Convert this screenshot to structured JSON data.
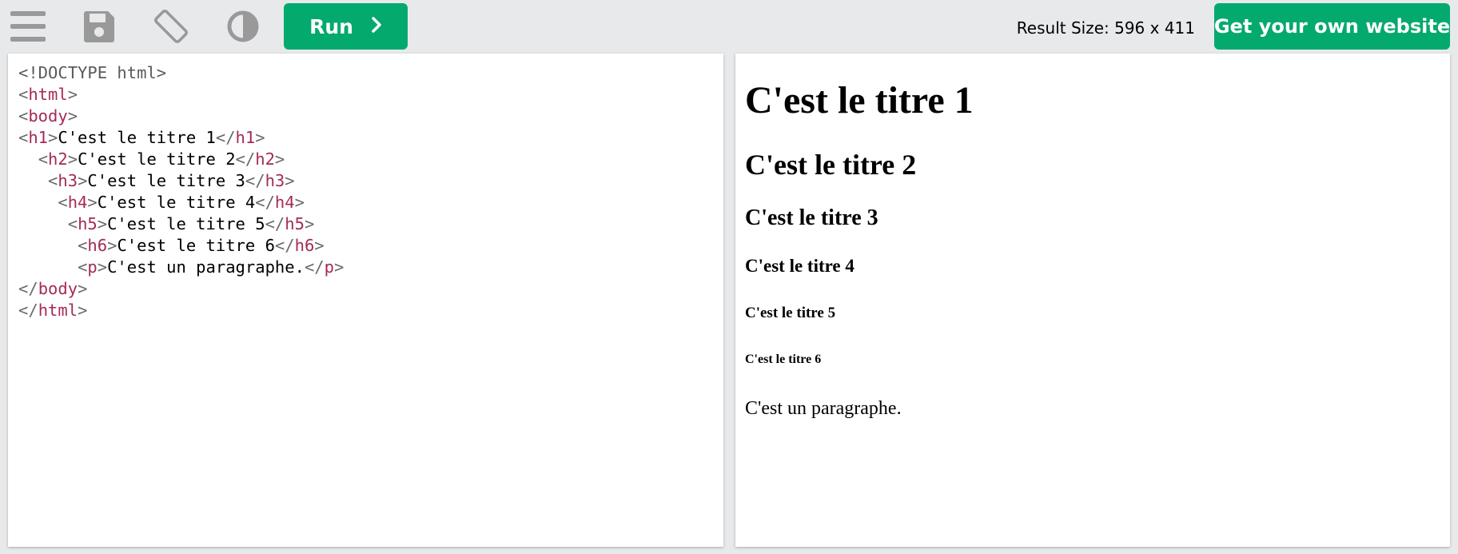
{
  "toolbar": {
    "menu_icon": "hamburger-menu-icon",
    "save_icon": "floppy-disk-icon",
    "rotate_icon": "rotate-screen-icon",
    "contrast_icon": "contrast-half-circle-icon",
    "run_label": "Run",
    "run_icon": "chevron-right-icon",
    "result_size": "Result Size: 596 x 411",
    "get_website_label": "Get your own website"
  },
  "colors": {
    "accent": "#04aa6d",
    "background": "#e7e9eb",
    "tag_color": "#a52a5a",
    "icon_color": "#999999"
  },
  "editor": {
    "lines": [
      {
        "indent": "",
        "text": "<!DOCTYPE html>",
        "kind": "doctype"
      },
      {
        "indent": "",
        "open": "html",
        "kind": "open"
      },
      {
        "indent": "",
        "open": "body",
        "kind": "open"
      },
      {
        "indent": "",
        "tag": "h1",
        "content": "C'est le titre 1",
        "kind": "element"
      },
      {
        "indent": "  ",
        "tag": "h2",
        "content": "C'est le titre 2",
        "kind": "element"
      },
      {
        "indent": "   ",
        "tag": "h3",
        "content": "C'est le titre 3",
        "kind": "element"
      },
      {
        "indent": "    ",
        "tag": "h4",
        "content": "C'est le titre 4",
        "kind": "element"
      },
      {
        "indent": "     ",
        "tag": "h5",
        "content": "C'est le titre 5",
        "kind": "element"
      },
      {
        "indent": "      ",
        "tag": "h6",
        "content": "C'est le titre 6",
        "kind": "element"
      },
      {
        "indent": "      ",
        "tag": "p",
        "content": "C'est un paragraphe.",
        "kind": "element"
      },
      {
        "indent": "",
        "close": "body",
        "kind": "close"
      },
      {
        "indent": "",
        "close": "html",
        "kind": "close"
      }
    ]
  },
  "result": {
    "h1": "C'est le titre 1",
    "h2": "C'est le titre 2",
    "h3": "C'est le titre 3",
    "h4": "C'est le titre 4",
    "h5": "C'est le titre 5",
    "h6": "C'est le titre 6",
    "p": "C'est un paragraphe."
  }
}
